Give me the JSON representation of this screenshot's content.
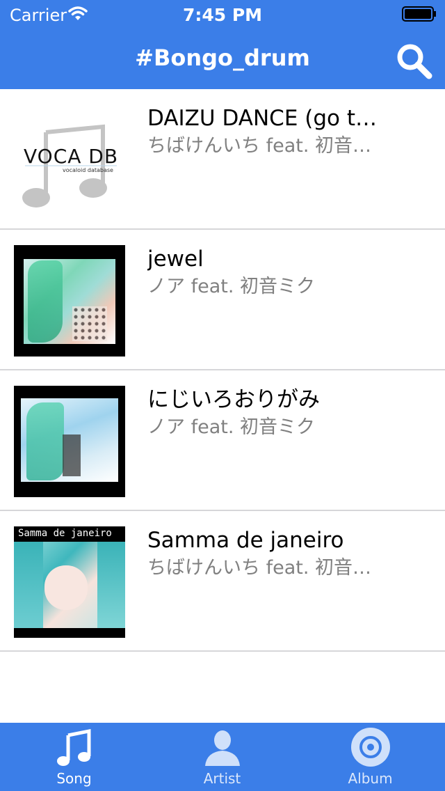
{
  "status_bar": {
    "carrier": "Carrier",
    "time": "7:45 PM"
  },
  "nav": {
    "title": "#Bongo_drum",
    "search_icon": "search-icon"
  },
  "songs": [
    {
      "title": "DAIZU DANCE (go t…",
      "artist": "ちばけんいち feat. 初音…",
      "thumb_text": "VOCA DB",
      "thumb_subtext": "vocaloid database"
    },
    {
      "title": "jewel",
      "artist": "ノア feat. 初音ミク"
    },
    {
      "title": "にじいろおりがみ",
      "artist": "ノア feat. 初音ミク"
    },
    {
      "title": "Samma de janeiro",
      "artist": "ちばけんいち feat. 初音…",
      "thumb_text": "Samma de janeiro"
    }
  ],
  "tabs": [
    {
      "label": "Song",
      "icon": "music-note-icon",
      "active": true
    },
    {
      "label": "Artist",
      "icon": "person-icon",
      "active": false
    },
    {
      "label": "Album",
      "icon": "disc-icon",
      "active": false
    }
  ],
  "colors": {
    "accent": "#3b7ee8",
    "separator": "#d6d6d9",
    "subtitle": "#808080"
  }
}
